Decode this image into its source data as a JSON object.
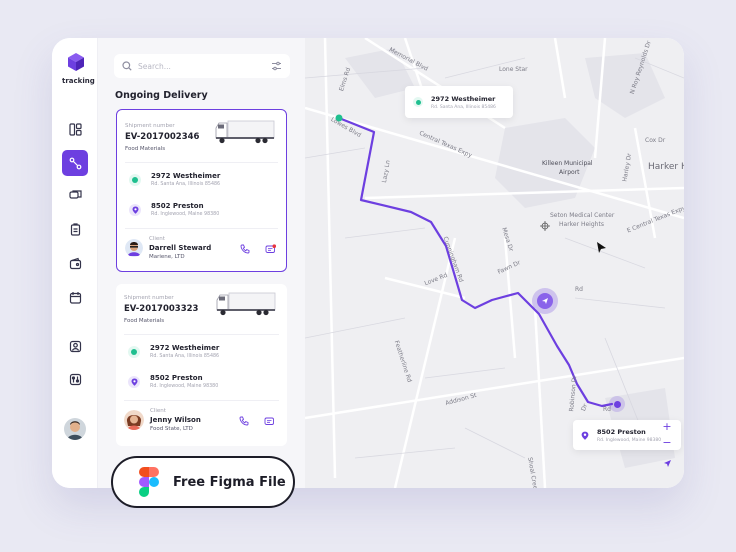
{
  "app": {
    "name": "tracking"
  },
  "search": {
    "placeholder": "Search..."
  },
  "panel": {
    "title": "Ongoing Delivery"
  },
  "shipments": [
    {
      "number_label": "Shipment number",
      "number": "EV-2017002346",
      "material": "Food Materials",
      "from": {
        "title": "2972 Westheimer",
        "address": "Rd. Santa Ana, Illinois 85486"
      },
      "to": {
        "title": "8502 Preston",
        "address": "Rd. Inglewood, Maine 98380"
      },
      "client": {
        "label": "Client",
        "name": "Darrell Steward",
        "company": "Mariene, LTD"
      }
    },
    {
      "number_label": "Shipment number",
      "number": "EV-2017003323",
      "material": "Food Materials",
      "from": {
        "title": "2972 Westheimer",
        "address": "Rd. Santa Ana, Illinois 85486"
      },
      "to": {
        "title": "8502 Preston",
        "address": "Rd. Inglewood, Maine 98380"
      },
      "client": {
        "label": "Client",
        "name": "Jenny Wilson",
        "company": "Food State, LTD"
      }
    }
  ],
  "map": {
    "labels": {
      "memorial": "Memorial Blvd",
      "lonestar": "Lone Star",
      "nreynolds": "N Roy Reynolds Dr",
      "elms": "Elms Rd",
      "lowes": "Lowes Blvd",
      "centraltx": "Central Texas Expy",
      "coxdr": "Cox Dr",
      "killeen1": "Killeen Municipal",
      "killeen2": "Airport",
      "harker": "Harker Heights",
      "harley": "Harley Dr",
      "lazy": "Lazy Ln",
      "seton1": "Seton Medical Center",
      "seton2": "Harker Heights",
      "ecentral": "E Central Texas Expy",
      "mesa": "Mesa Dr",
      "cunningham": "Cunningham Rd",
      "fawn": "Fawn Dr",
      "love": "Love Rd",
      "rd1": "Rd",
      "featherline": "Featherline Rd",
      "robinson": "Robinson Dr",
      "addison": "Addison St",
      "dr1": "Dr",
      "rd2": "Rd",
      "shoal": "Shoal Creek Dr"
    },
    "origin": {
      "title": "2972 Westheimer",
      "address": "Rd. Santa Ana, Illinois 85486"
    },
    "destination": {
      "title": "8502 Preston",
      "address": "Rd. Inglewood, Maine 98380"
    }
  },
  "promo": {
    "label": "Free Figma File"
  },
  "colors": {
    "accent": "#6d3fe0",
    "origin": "#1fbf8f",
    "alert": "#e8343f"
  }
}
